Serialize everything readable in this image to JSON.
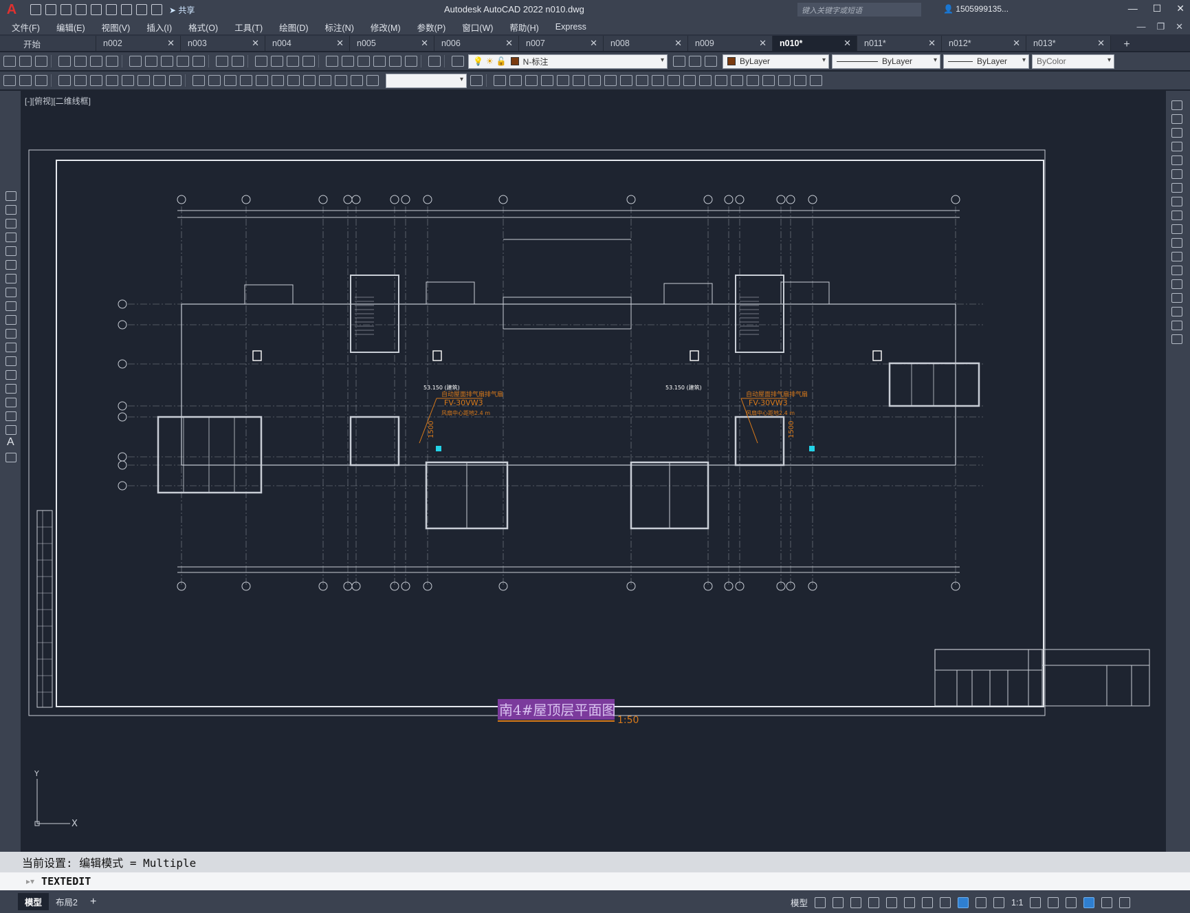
{
  "app": {
    "logo": "A",
    "title": "Autodesk AutoCAD 2022    n010.dwg",
    "search_placeholder": "键入关键字或短语",
    "user": "1505999135...",
    "share_label": "共享"
  },
  "menu": [
    "文件(F)",
    "编辑(E)",
    "视图(V)",
    "插入(I)",
    "格式(O)",
    "工具(T)",
    "绘图(D)",
    "标注(N)",
    "修改(M)",
    "参数(P)",
    "窗口(W)",
    "帮助(H)",
    "Express"
  ],
  "tabs": [
    {
      "label": "开始",
      "active": false
    },
    {
      "label": "n002",
      "active": false
    },
    {
      "label": "n003",
      "active": false
    },
    {
      "label": "n004",
      "active": false
    },
    {
      "label": "n005",
      "active": false
    },
    {
      "label": "n006",
      "active": false
    },
    {
      "label": "n007",
      "active": false
    },
    {
      "label": "n008",
      "active": false
    },
    {
      "label": "n009",
      "active": false
    },
    {
      "label": "n010*",
      "active": true
    },
    {
      "label": "n011*",
      "active": false
    },
    {
      "label": "n012*",
      "active": false
    },
    {
      "label": "n013*",
      "active": false
    }
  ],
  "properties": {
    "layer": "N-标注",
    "color": "ByLayer",
    "linetype": "ByLayer",
    "lineweight": "ByLayer",
    "plotstyle": "ByColor",
    "color_swatch": "#7a3b10"
  },
  "viewport": {
    "label": "[-][俯视][二维线框]"
  },
  "drawing": {
    "title_text": "南4#屋顶层平面图",
    "scale_text": "1:50",
    "annotations": {
      "fan_label_1": "自动屋面排气扇排气扇",
      "fan_model_1": "FV-30VW3",
      "fan_note_1": "风扇中心距地2.4 m",
      "elev_1": "53.150 (建筑)",
      "elev_2": "53.150 (建筑)",
      "dim_1500": "1500"
    },
    "colors": {
      "line": "#c9ced6",
      "dim_orange": "#d97a1a",
      "title_bg": "#7b3a9c",
      "title_text": "#d9c2f0",
      "highlight": "#23d3e8"
    }
  },
  "command": {
    "history": "当前设置: 编辑模式 = Multiple",
    "current": "TEXTEDIT"
  },
  "status": {
    "layouts": [
      {
        "label": "模型",
        "active": true
      },
      {
        "label": "布局2",
        "active": false
      }
    ],
    "model_label": "模型",
    "scale": "1:1"
  }
}
